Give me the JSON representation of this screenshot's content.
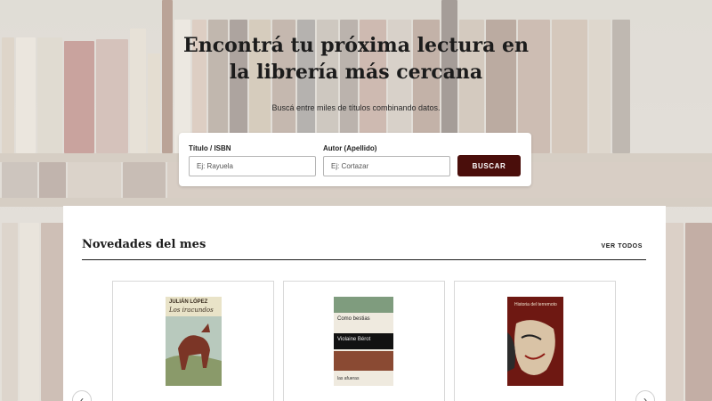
{
  "hero": {
    "title_line1": "Encontrá tu próxima lectura en",
    "title_line2": "la librería más cercana",
    "subtitle": "Buscá entre miles de títulos combinando datos."
  },
  "search": {
    "title_label": "Título / ISBN",
    "title_placeholder": "Ej: Rayuela",
    "author_label": "Autor (Apellido)",
    "author_placeholder": "Ej: Cortazar",
    "button_label": "BUSCAR"
  },
  "news": {
    "heading": "Novedades del mes",
    "see_all": "VER TODOS",
    "books": [
      {
        "cover_author": "JULIÁN LÓPEZ",
        "cover_title": "Los iracundos"
      },
      {
        "cover_title": "Como bestias",
        "cover_author": "Violaine Bérot",
        "cover_publisher": "las afueras"
      },
      {
        "cover_title": "Historia del terremoto"
      }
    ]
  },
  "colors": {
    "accent": "#4a0e0b",
    "panel": "#ffffff"
  },
  "icons": {
    "prev": "chevron-left-icon",
    "next": "chevron-right-icon"
  }
}
